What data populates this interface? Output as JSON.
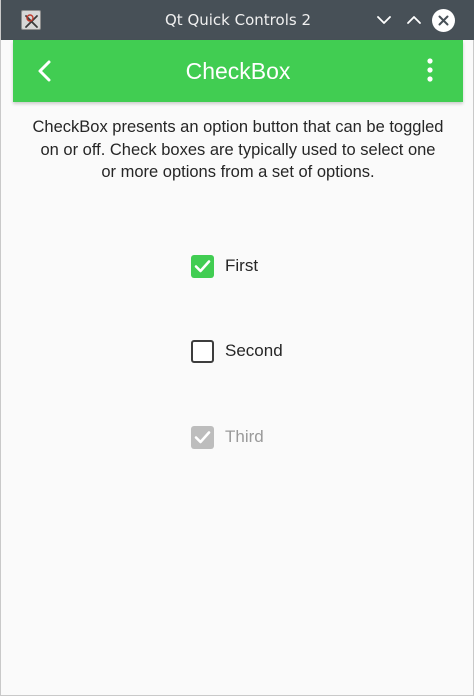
{
  "window": {
    "title": "Qt Quick Controls 2",
    "app_icon": "qt-x-icon",
    "controls": [
      "minimize-icon",
      "maximize-icon",
      "close-icon"
    ]
  },
  "header": {
    "title": "CheckBox",
    "back_icon": "back-chevron-icon",
    "menu_icon": "more-vertical-icon",
    "color": "#41cd52"
  },
  "description": "CheckBox presents an option button that can be toggled on or off. Check boxes are typically used to select one or more options from a set of options.",
  "checkboxes": [
    {
      "label": "First",
      "checked": true,
      "enabled": true
    },
    {
      "label": "Second",
      "checked": false,
      "enabled": true
    },
    {
      "label": "Third",
      "checked": true,
      "enabled": false
    }
  ],
  "colors": {
    "accent": "#41cd52",
    "titlebar": "#475057",
    "disabled": "#bdbdbd"
  }
}
